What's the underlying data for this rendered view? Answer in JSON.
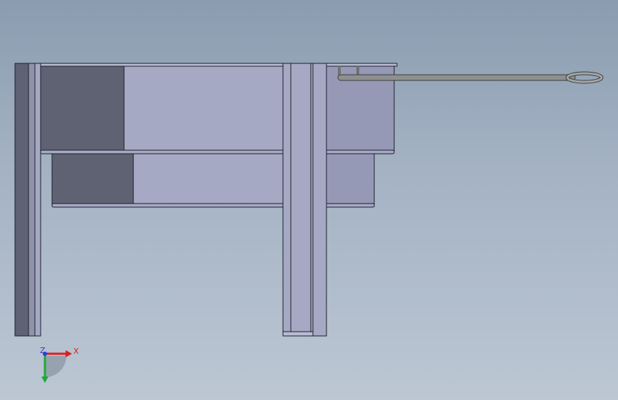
{
  "viewport": {
    "background_top": "#8a9cb0",
    "background_bottom": "#bcc7d3"
  },
  "model": {
    "face_light_color": "#a6a9c4",
    "face_dark_color": "#5f6272",
    "edge_color": "#1c1f2a",
    "rod_color": "#8e9090"
  },
  "triad": {
    "x_label": "X",
    "y_label": "Y",
    "z_label": "Z",
    "x_color": "#d91f1f",
    "y_color": "#1fa83a",
    "z_color": "#2b3fd0"
  }
}
